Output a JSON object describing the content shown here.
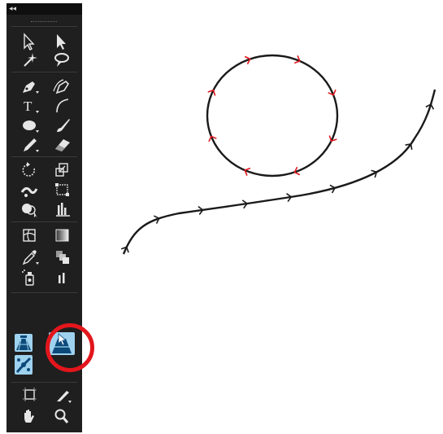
{
  "toolbar": {
    "collapse_label": "◂◂",
    "tools": [
      {
        "name": "selection-tool",
        "icon": "arrow-outline-icon"
      },
      {
        "name": "direct-selection-tool",
        "icon": "arrow-filled-icon"
      },
      {
        "name": "magic-wand-tool",
        "icon": "magic-wand-icon"
      },
      {
        "name": "lasso-tool",
        "icon": "lasso-icon"
      },
      {
        "name": "pen-tool",
        "icon": "pen-icon"
      },
      {
        "name": "curvature-tool",
        "icon": "curvature-pen-icon"
      },
      {
        "name": "type-tool",
        "icon": "type-icon",
        "label": "T"
      },
      {
        "name": "line-segment-tool",
        "icon": "arc-icon"
      },
      {
        "name": "ellipse-tool",
        "icon": "ellipse-icon"
      },
      {
        "name": "paintbrush-tool",
        "icon": "brush-icon"
      },
      {
        "name": "pencil-tool",
        "icon": "pencil-icon"
      },
      {
        "name": "eraser-tool",
        "icon": "eraser-icon"
      },
      {
        "name": "rotate-tool",
        "icon": "rotate-icon"
      },
      {
        "name": "scale-tool",
        "icon": "scale-icon"
      },
      {
        "name": "warp-tool",
        "icon": "warp-icon"
      },
      {
        "name": "free-transform-tool",
        "icon": "free-transform-icon"
      },
      {
        "name": "shape-builder-tool",
        "icon": "shape-builder-icon"
      },
      {
        "name": "column-graph-tool",
        "icon": "graph-icon"
      },
      {
        "name": "mesh-tool",
        "icon": "mesh-icon"
      },
      {
        "name": "gradient-tool",
        "icon": "gradient-icon"
      },
      {
        "name": "eyedropper-tool",
        "icon": "eyedropper-icon"
      },
      {
        "name": "blend-tool",
        "icon": "blend-icon"
      },
      {
        "name": "symbol-sprayer-tool",
        "icon": "symbol-sprayer-icon"
      },
      {
        "name": "bar-graph-tool",
        "icon": "bar-graph-icon"
      },
      {
        "name": "perspective-grid-tool",
        "icon": "perspective-grid-icon"
      },
      {
        "name": "perspective-selection-tool",
        "icon": "perspective-selection-icon",
        "highlighted": true
      },
      {
        "name": "puppet-warp-tool",
        "icon": "puppet-warp-icon"
      },
      {
        "name": "artboard-tool",
        "icon": "artboard-icon"
      },
      {
        "name": "slice-tool",
        "icon": "slice-icon"
      },
      {
        "name": "hand-tool",
        "icon": "hand-icon"
      },
      {
        "name": "zoom-tool",
        "icon": "zoom-icon"
      }
    ]
  },
  "canvas": {
    "paths": [
      {
        "name": "circle-path",
        "stroke": "#1a1a1a",
        "arrow_color": "#e3161c",
        "arrow_count": 8
      },
      {
        "name": "s-curve-path",
        "stroke": "#1a1a1a",
        "arrow_color": "#1a1a1a",
        "arrow_count": 9
      }
    ]
  },
  "colors": {
    "toolbar_bg": "#1f1f1f",
    "icon": "#e6e6e6",
    "selected_tool_bg": "#9fd2ef",
    "highlight_ring": "#e3161c"
  }
}
